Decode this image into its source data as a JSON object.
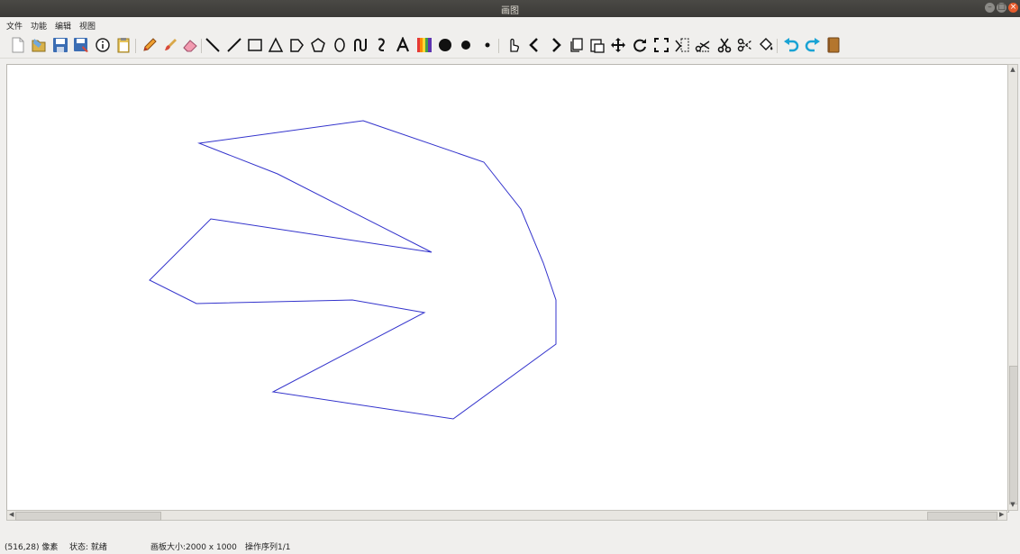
{
  "window": {
    "title": "画图"
  },
  "menu": [
    "文件",
    "功能",
    "编辑",
    "视图"
  ],
  "toolbar": {
    "tools": [
      "new-file-icon",
      "open-file-icon",
      "save-icon",
      "save-as-icon",
      "info-icon",
      "paste-icon",
      "pencil-icon",
      "brush-icon",
      "eraser-icon",
      "line-thin-icon",
      "line-icon",
      "rectangle-icon",
      "triangle-icon",
      "pentagon-icon",
      "polygon-icon",
      "ellipse-icon",
      "curve-icon",
      "spline-icon",
      "text-icon",
      "color-palette-icon",
      "pen-size-large-icon",
      "pen-size-medium-icon",
      "pen-size-small-icon",
      "select-hand-icon",
      "prev-icon",
      "next-icon",
      "copy-icon",
      "paste-clip-icon",
      "move-icon",
      "rotate-icon",
      "fullscreen-icon",
      "crop-icon",
      "cut-shape-icon",
      "scissors-icon",
      "cut-icon",
      "fill-bucket-icon",
      "undo-icon",
      "redo-icon",
      "notebook-icon"
    ]
  },
  "canvas": {
    "background": "#ffffff",
    "stroke_color": "#3333cc"
  },
  "status": {
    "coords": "(516,28) 像素",
    "state": "状态: 就绪",
    "canvas_size": "画板大小:2000 x 1000",
    "ops": "操作序列1/1"
  }
}
